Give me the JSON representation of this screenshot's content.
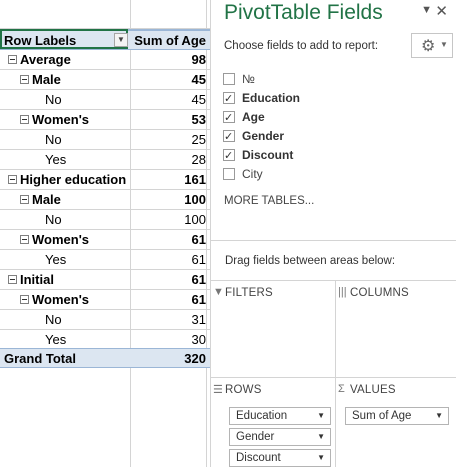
{
  "pivot": {
    "header": {
      "row_labels": "Row Labels",
      "sum_label": "Sum of Age",
      "filter_icon": "dropdown-arrow-icon"
    },
    "rows": [
      {
        "label": "Average",
        "value": "98",
        "level": 0,
        "bold": true,
        "toggle": true
      },
      {
        "label": "Male",
        "value": "45",
        "level": 1,
        "bold": true,
        "toggle": true
      },
      {
        "label": "No",
        "value": "45",
        "level": 2,
        "bold": false,
        "toggle": false
      },
      {
        "label": "Women's",
        "value": "53",
        "level": 1,
        "bold": true,
        "toggle": true
      },
      {
        "label": "No",
        "value": "25",
        "level": 2,
        "bold": false,
        "toggle": false
      },
      {
        "label": "Yes",
        "value": "28",
        "level": 2,
        "bold": false,
        "toggle": false
      },
      {
        "label": "Higher education",
        "value": "161",
        "level": 0,
        "bold": true,
        "toggle": true
      },
      {
        "label": "Male",
        "value": "100",
        "level": 1,
        "bold": true,
        "toggle": true
      },
      {
        "label": "No",
        "value": "100",
        "level": 2,
        "bold": false,
        "toggle": false
      },
      {
        "label": "Women's",
        "value": "61",
        "level": 1,
        "bold": true,
        "toggle": true
      },
      {
        "label": "Yes",
        "value": "61",
        "level": 2,
        "bold": false,
        "toggle": false
      },
      {
        "label": "Initial",
        "value": "61",
        "level": 0,
        "bold": true,
        "toggle": true
      },
      {
        "label": "Women's",
        "value": "61",
        "level": 1,
        "bold": true,
        "toggle": true
      },
      {
        "label": "No",
        "value": "31",
        "level": 2,
        "bold": false,
        "toggle": false
      },
      {
        "label": "Yes",
        "value": "30",
        "level": 2,
        "bold": false,
        "toggle": false
      }
    ],
    "grand_total": {
      "label": "Grand Total",
      "value": "320"
    }
  },
  "pane": {
    "title": "PivotTable Fields",
    "choose_label": "Choose fields to add to report:",
    "close_icon": "close-icon",
    "gear_icon": "gear-icon",
    "fields": [
      {
        "label": "№",
        "checked": false
      },
      {
        "label": "Education",
        "checked": true
      },
      {
        "label": "Age",
        "checked": true
      },
      {
        "label": "Gender",
        "checked": true
      },
      {
        "label": "Discount",
        "checked": true
      },
      {
        "label": "City",
        "checked": false
      }
    ],
    "more_tables": "MORE TABLES...",
    "drag_label": "Drag fields between areas below:",
    "areas": {
      "filters": {
        "title": "FILTERS",
        "icon": "filter-icon",
        "items": []
      },
      "columns": {
        "title": "COLUMNS",
        "icon": "columns-icon",
        "items": []
      },
      "rows": {
        "title": "ROWS",
        "icon": "rows-icon",
        "items": [
          "Education",
          "Gender",
          "Discount"
        ]
      },
      "values": {
        "title": "VALUES",
        "icon": "sigma-icon",
        "items": [
          "Sum of Age"
        ]
      }
    }
  },
  "colors": {
    "accent": "#217346",
    "header_fill": "#dce6f1",
    "grid": "#d4d4d4"
  }
}
